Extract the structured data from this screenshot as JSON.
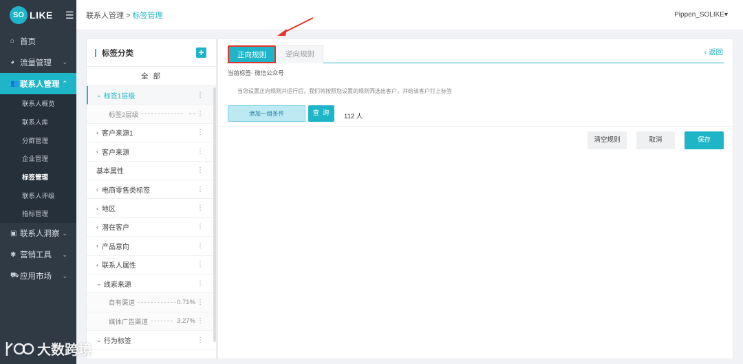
{
  "brand": {
    "logo_circle": "SO",
    "logo_text": "LIKE"
  },
  "sidebar": {
    "items": [
      {
        "label": "首页",
        "icon": "home-icon"
      },
      {
        "label": "流量管理",
        "icon": "chart-pie-icon"
      },
      {
        "label": "联系人管理",
        "icon": "users-icon"
      },
      {
        "label": "联系人洞察",
        "icon": "id-card-icon"
      },
      {
        "label": "营销工具",
        "icon": "tools-icon"
      },
      {
        "label": "应用市场",
        "icon": "cart-icon"
      }
    ],
    "sub_items": [
      "联系人概览",
      "联系人库",
      "分群管理",
      "企业管理",
      "标签管理",
      "联系人评级",
      "指标管理"
    ]
  },
  "header": {
    "breadcrumb_parent": "联系人管理",
    "breadcrumb_sep": " > ",
    "breadcrumb_current": "标签管理",
    "user": "Pippen_SOLIKE"
  },
  "category": {
    "title": "标签分类",
    "all": "全 部",
    "rows": [
      {
        "label": "标签1层级",
        "arrow": "⌄"
      },
      {
        "label": "标签2层级",
        "leader": "- - - - - - - - - - - - -",
        "tail": "- -"
      },
      {
        "label": "客户来源1",
        "arrow": "‹"
      },
      {
        "label": "客户来源",
        "arrow": "‹"
      },
      {
        "label": "基本属性"
      },
      {
        "label": "电商零售类标签",
        "arrow": "‹"
      },
      {
        "label": "地区",
        "arrow": "‹"
      },
      {
        "label": "潜在客户",
        "arrow": "‹"
      },
      {
        "label": "产品意向",
        "arrow": "‹"
      },
      {
        "label": "联系人属性",
        "arrow": "‹"
      },
      {
        "label": "线索来源",
        "arrow": "⌄"
      },
      {
        "label": "自有渠道",
        "leader": "- - - - - - - - - - - -",
        "pct": "0.71%"
      },
      {
        "label": "媒体广告渠道",
        "leader": "- - - - - - -",
        "pct": "3.27%"
      },
      {
        "label": "行为标签",
        "arrow": "⌄"
      }
    ]
  },
  "main": {
    "tab_forward": "正向规则",
    "tab_reverse": "逆向规则",
    "back": "返回",
    "current_tag": "当前标签- 微信公众号",
    "description": "当您设置正向规则并运行后，我们将按照您设置的规则筛选出客户，并给该客户打上标签",
    "add_group": "添加一组条件",
    "query": "查 询",
    "count": "112  人",
    "clear": "清空规则",
    "cancel": "取消",
    "save": "保存"
  },
  "watermark": {
    "text": "大数跨境"
  },
  "colors": {
    "accent": "#1fb5c8",
    "sidebar_bg": "#2f3a45",
    "annotation": "#e0352b"
  }
}
